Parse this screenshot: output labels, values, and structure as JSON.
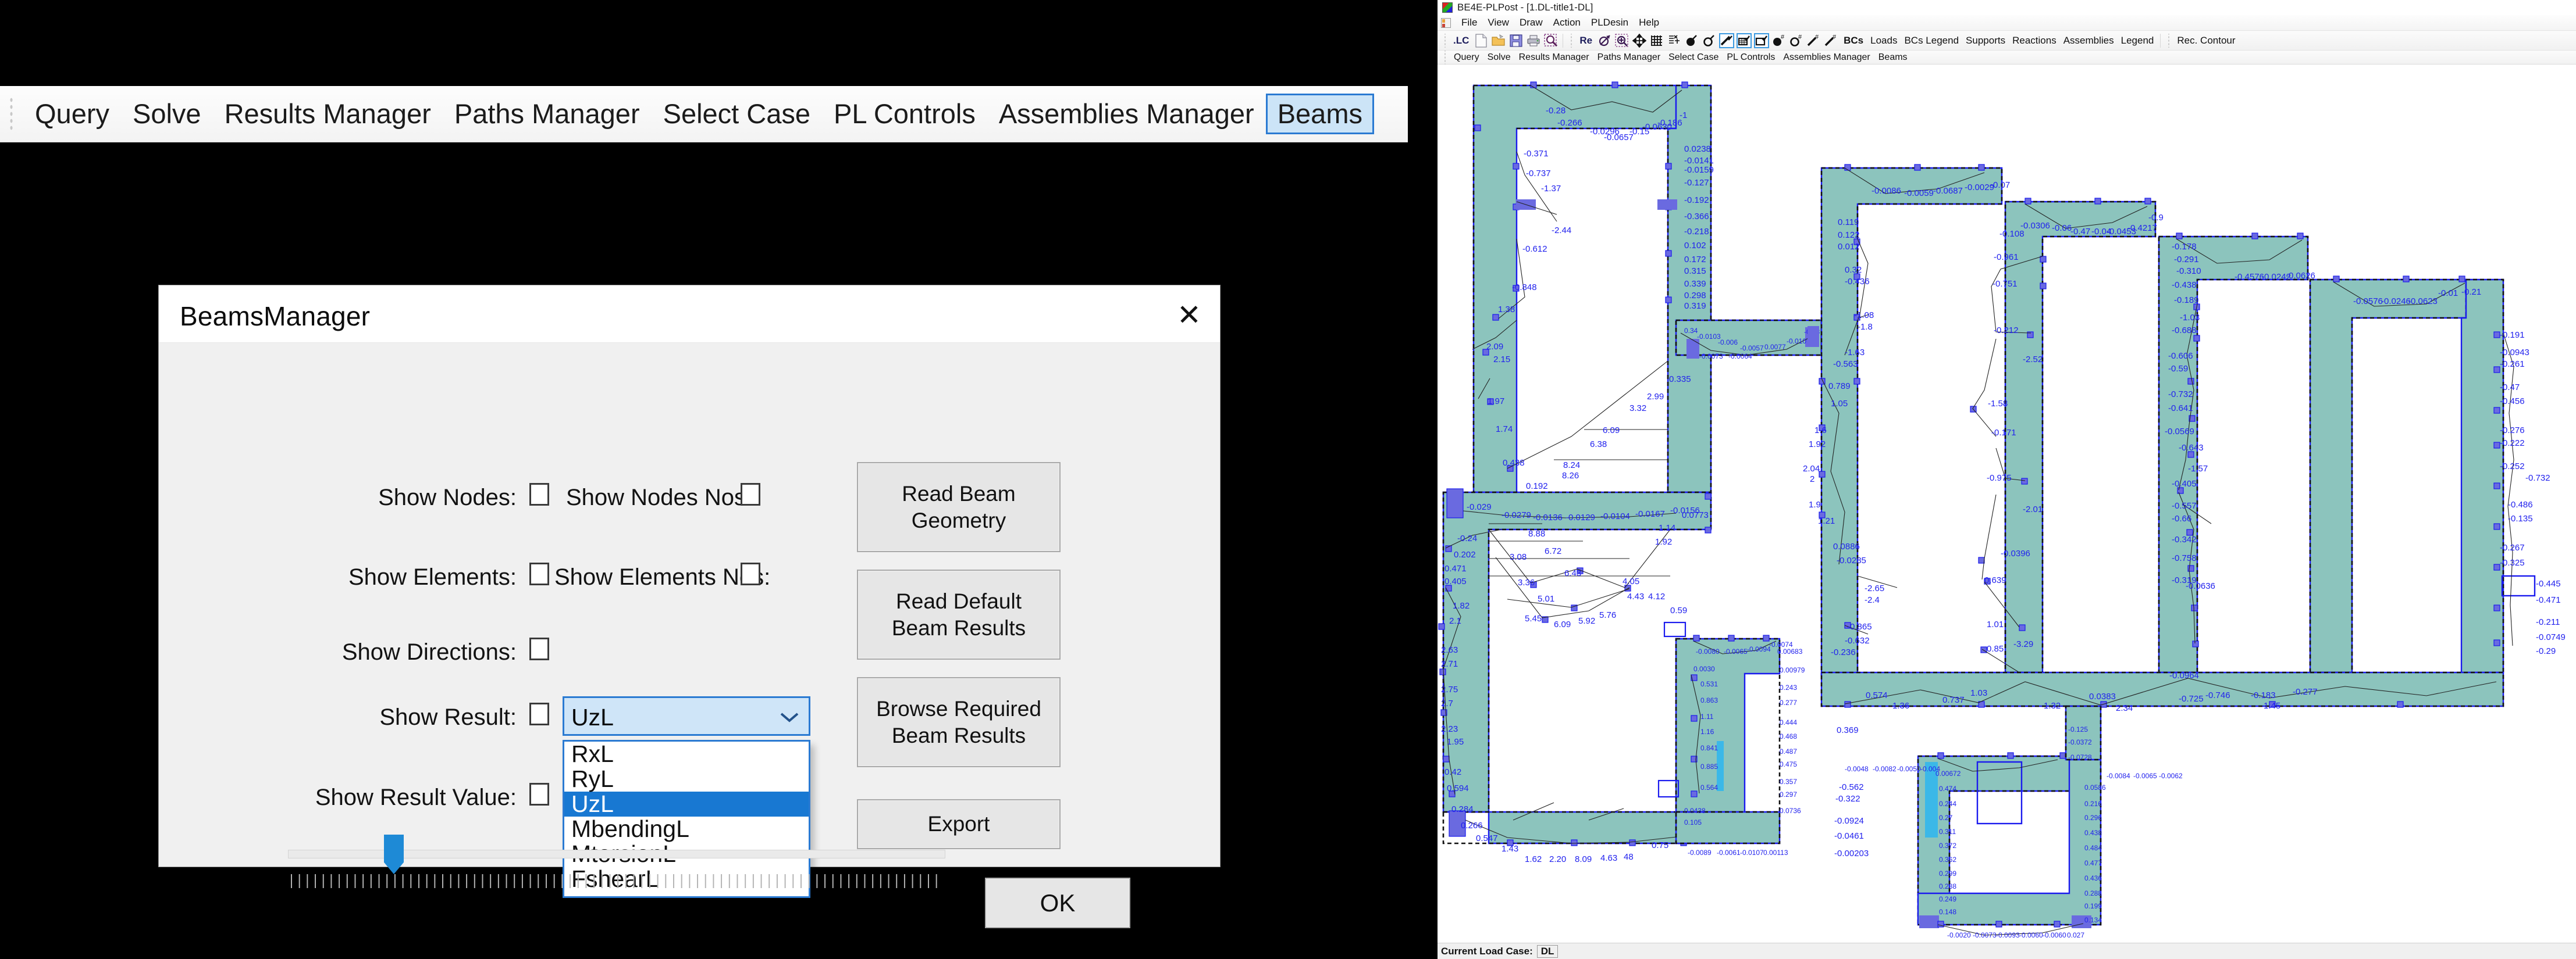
{
  "big_menubar": {
    "items": [
      {
        "label": "Query",
        "selected": false
      },
      {
        "label": "Solve",
        "selected": false
      },
      {
        "label": "Results Manager",
        "selected": false
      },
      {
        "label": "Paths Manager",
        "selected": false
      },
      {
        "label": "Select Case",
        "selected": false
      },
      {
        "label": "PL Controls",
        "selected": false
      },
      {
        "label": "Assemblies Manager",
        "selected": false
      },
      {
        "label": "Beams",
        "selected": true
      }
    ]
  },
  "dialog": {
    "title": "BeamsManager",
    "close_icon": "✕",
    "checkboxes": [
      {
        "label": "Show Nodes:",
        "checked": false
      },
      {
        "label": "Show Nodes Nos:",
        "checked": false
      },
      {
        "label": "Show Elements:",
        "checked": false
      },
      {
        "label": "Show Elements Nos:",
        "checked": false
      },
      {
        "label": "Show Directions:",
        "checked": false
      },
      {
        "label": "Show Result:",
        "checked": false
      },
      {
        "label": "Show Result Value:",
        "checked": false
      }
    ],
    "buttons": [
      {
        "label": "Read Beam\nGeometry"
      },
      {
        "label": "Read  Default\nBeam Results"
      },
      {
        "label": "Browse Required\nBeam Results"
      },
      {
        "label": "Export"
      },
      {
        "label": "OK"
      }
    ],
    "combo": {
      "value": "UzL",
      "arrow_icon": "chevron-down-icon",
      "options": [
        "RxL",
        "RyL",
        "UzL",
        "MbendingL",
        "MtorsionL",
        "FshearL"
      ],
      "highlighted": "UzL",
      "expanded": true
    },
    "slider": {
      "value_percent": 15,
      "min": 0,
      "max": 100
    }
  },
  "app": {
    "title": "BE4E-PLPost - [1.DL-title1-DL]",
    "icon": "app-logo-icon",
    "menu": [
      "File",
      "View",
      "Draw",
      "Action",
      "PLDesin",
      "Help"
    ],
    "toolbar": {
      "group1_text": ".LC",
      "group1_icons": [
        "new-document-icon",
        "open-folder-icon",
        "save-floppy-icon",
        "print-icon",
        "zoom-search-icon"
      ],
      "group2_text": "Re",
      "group2_icons": [
        "rotate-icon",
        "zoom-in-region-icon",
        "pan-move-icon",
        "mesh-grid-icon",
        "mesh-axes-icon",
        "node-solid-icon",
        "node-hollow-icon",
        "element-line-check-icon",
        "element-shell-check-icon",
        "element-plate-check-icon",
        "node-solid-num-icon",
        "node-hollow-num-icon",
        "element-line-num-icon",
        "element-shell-num-icon"
      ],
      "bcs_text": "BCs",
      "links": [
        "Loads",
        "BCs Legend",
        "Supports",
        "Reactions",
        "Assemblies",
        "Legend"
      ],
      "last_link": "Rec. Contour"
    },
    "menubar2": [
      {
        "label": "Query",
        "selected": false
      },
      {
        "label": "Solve",
        "selected": false
      },
      {
        "label": "Results Manager",
        "selected": false
      },
      {
        "label": "Paths Manager",
        "selected": false
      },
      {
        "label": "Select Case",
        "selected": false
      },
      {
        "label": "PL Controls",
        "selected": false
      },
      {
        "label": "Assemblies Manager",
        "selected": false
      },
      {
        "label": "Beams",
        "selected": false
      }
    ],
    "statusbar": {
      "label": "Current Load Case:",
      "value": "DL"
    },
    "canvas": {
      "description": "structural floor plan with beam result annotations",
      "wall_fill": "#8cc4bd",
      "annotation_color": "#2222ee",
      "node_color": "#6a6ae0",
      "result_values": [
        "-0.28",
        "-0.266",
        "-0.0296",
        "-0.0657",
        "-0.15",
        "-0.0630",
        "-0.186",
        "-1",
        "0.0238",
        "-0.0141",
        "-0.0159",
        "-0.127",
        "-0.192",
        "-0.366",
        "-0.218",
        "-0.371",
        "-0.737",
        "-1.37",
        "-2.44",
        "-0.612",
        "-0.848",
        "1.38",
        "2.09",
        "2.15",
        "1.97",
        "1.74",
        "0.438",
        "0.192",
        "0.102",
        "0.172",
        "0.315",
        "0.339",
        "0.298",
        "0.319",
        "0.335",
        "2.99",
        "3.32",
        "6.09",
        "6.38",
        "8.24",
        "8.26",
        "0.0773",
        "0.24",
        "0.202",
        "0.471",
        "0.405",
        "1.82",
        "2.1",
        "2.63",
        "2.71",
        "2.75",
        "2.7",
        "2.23",
        "1.95",
        "0.42",
        "0.594",
        "0.284",
        "0.266",
        "0.547",
        "1.43",
        "1.62",
        "2.20",
        "8.09",
        "4.63",
        "48",
        "0.75",
        "3.08",
        "8.88",
        "6.72",
        "6.43",
        "3.36",
        "5.01",
        "5.45",
        "6.09",
        "5.92",
        "5.76",
        "4.05",
        "4.43",
        "4.12",
        "1.14",
        "1.92",
        "0.119",
        "0.122",
        "0.012",
        "0.32",
        "-0.436",
        "-1.08",
        "-1.8",
        "-1.63",
        "-0.563",
        "0.789",
        "1.05",
        "1.6",
        "1.92",
        "2.04",
        "0.0886",
        "-0.0285",
        "-2.65",
        "-2.4",
        "-0.865",
        "-0.632",
        "-0.236",
        "-0.21",
        "0.35",
        "0.323",
        "0.369",
        "-0.562",
        "-0.322",
        "-0.0924",
        "-0.0461",
        "-0.00203",
        "0.00683",
        "0.00979",
        "0.243",
        "0.277",
        "0.444",
        "0.468",
        "0.487",
        "0.475",
        "0.357",
        "0.297",
        "0.0736",
        "0.0438",
        "0.105",
        "0.531",
        "0.863",
        "1.11",
        "1.16",
        "0.841",
        "0.885",
        "0.564",
        "0.00113",
        "-0.108",
        "-0.961",
        "-0.751",
        "-0.212",
        "-2.52",
        "-1.58",
        "-0.171",
        "-0.975",
        "-2.01",
        "-0.0396",
        "0.639",
        "1.01",
        "-3.29",
        "0.85",
        "0.0964",
        "0.574",
        "1.36",
        "0.737",
        "1.03",
        "1.32",
        "0.0383",
        "2.34",
        "-0.178",
        "-0.291",
        "-0.310",
        "-0.438",
        "-0.189",
        "-1.03",
        "-0.688",
        "-0.606",
        "-0.59",
        "-0.732",
        "-0.641",
        "-0.0569",
        "-0.643",
        "-1.57",
        "-0.405",
        "-0.557",
        "-0.66",
        "-0.342",
        "-0.758",
        "-0.319",
        "-0.0636",
        "-0.725",
        "-0.746",
        "-0.183",
        "1.45",
        "-0.125",
        "-0.0372",
        "-0.0728",
        "-0.191",
        "-0.0943",
        "-0.261",
        "-0.47",
        "-0.456",
        "-0.276",
        "-0.222",
        "-0.252",
        "-0.732",
        "-0.486",
        "-0.135",
        "-0.267",
        "-0.325",
        "-0.445",
        "-0.471",
        "-0.211",
        "-0.0749",
        "-0.29",
        "-0.277",
        "0.00672",
        "0.474",
        "0.244",
        "0.27",
        "0.311",
        "0.372",
        "0.362",
        "0.299",
        "0.288",
        "0.249",
        "0.148",
        "0.0586",
        "0.216",
        "0.296",
        "0.438",
        "0.484",
        "0.477",
        "0.436",
        "0.288",
        "0.199",
        "0.134",
        "0.027"
      ]
    }
  }
}
